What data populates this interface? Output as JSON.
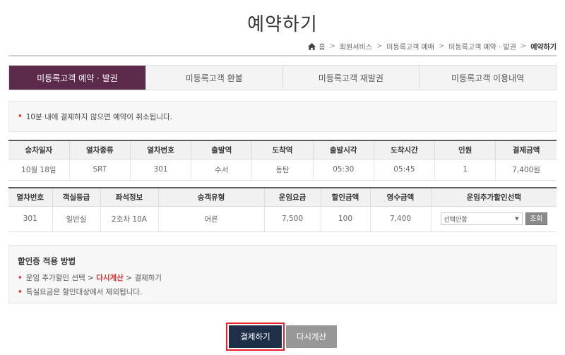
{
  "page_title": "예약하기",
  "breadcrumb": {
    "home": "홈",
    "items": [
      "회원서비스",
      "미등록고객 예매",
      "미등록고객 예약 · 발권"
    ],
    "current": "예약하기"
  },
  "tabs": [
    {
      "label": "미등록고객 예약 · 발권",
      "active": true
    },
    {
      "label": "미등록고객 환불",
      "active": false
    },
    {
      "label": "미등록고객 재발권",
      "active": false
    },
    {
      "label": "미등록고객 이용내역",
      "active": false
    }
  ],
  "notice": "10분 내에 결제하지 않으면 예약이 취소됩니다.",
  "train_table": {
    "headers": [
      "승차일자",
      "열차종류",
      "열차번호",
      "출발역",
      "도착역",
      "출발시각",
      "도착시간",
      "인원",
      "결제금액"
    ],
    "row": [
      "10월 18일",
      "SRT",
      "301",
      "수서",
      "동탄",
      "05:30",
      "05:45",
      "1",
      "7,400원"
    ]
  },
  "fare_table": {
    "headers": [
      "열차번호",
      "객실등급",
      "좌석정보",
      "승객유형",
      "운임요금",
      "할인금액",
      "영수금액",
      "운임추가할인선택"
    ],
    "row": [
      "301",
      "일반실",
      "2호차 10A",
      "어른",
      "7,500",
      "100",
      "7,400"
    ],
    "discount_select": "선택안함",
    "lookup_button": "조회"
  },
  "info": {
    "title": "할인증 적용 방법",
    "line1_a": "운임 추가할인 선택",
    "line1_b": "다시계산",
    "line1_c": "결제하기",
    "line2": "특실요금은 할인대상에서 제외됩니다."
  },
  "buttons": {
    "pay": "결제하기",
    "recalc": "다시계산"
  },
  "colors": {
    "active_tab": "#5c2a4a",
    "pay_button": "#1e2f47",
    "highlight": "#d8302f",
    "focus_border": "#e3222a"
  }
}
